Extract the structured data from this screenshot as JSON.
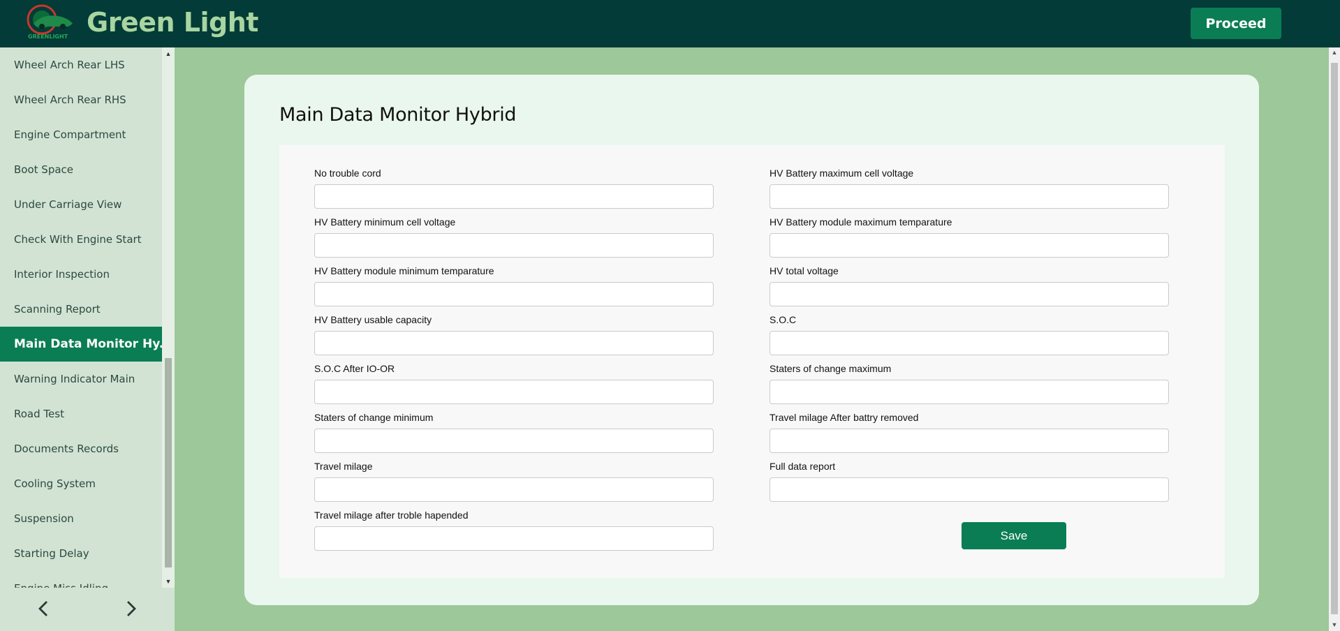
{
  "app": {
    "brand": "Green Light",
    "logo_text": "GREENLIGHT",
    "proceed_label": "Proceed"
  },
  "sidebar": {
    "items": [
      {
        "label": "Wheel Arch Rear LHS",
        "active": false
      },
      {
        "label": "Wheel Arch Rear RHS",
        "active": false
      },
      {
        "label": "Engine Compartment",
        "active": false
      },
      {
        "label": "Boot Space",
        "active": false
      },
      {
        "label": "Under Carriage View",
        "active": false
      },
      {
        "label": "Check With Engine Start",
        "active": false
      },
      {
        "label": "Interior Inspection",
        "active": false
      },
      {
        "label": "Scanning Report",
        "active": false
      },
      {
        "label": "Main Data Monitor Hy...",
        "active": true
      },
      {
        "label": "Warning Indicator Main",
        "active": false
      },
      {
        "label": "Road Test",
        "active": false
      },
      {
        "label": "Documents Records",
        "active": false
      },
      {
        "label": "Cooling System",
        "active": false
      },
      {
        "label": "Suspension",
        "active": false
      },
      {
        "label": "Starting Delay",
        "active": false
      },
      {
        "label": "Engine Miss Idling",
        "active": false
      }
    ],
    "prev_icon": "chevron-left-icon",
    "next_icon": "chevron-right-icon"
  },
  "main": {
    "title": "Main Data Monitor Hybrid",
    "fields": [
      {
        "label": "No trouble cord",
        "value": ""
      },
      {
        "label": "HV Battery maximum cell voltage",
        "value": ""
      },
      {
        "label": "HV Battery minimum cell voltage",
        "value": ""
      },
      {
        "label": "HV Battery module maximum temparature",
        "value": ""
      },
      {
        "label": "HV Battery module minimum temparature",
        "value": ""
      },
      {
        "label": "HV total voltage",
        "value": ""
      },
      {
        "label": "HV Battery usable capacity",
        "value": ""
      },
      {
        "label": "S.O.C",
        "value": ""
      },
      {
        "label": "S.O.C After IO-OR",
        "value": ""
      },
      {
        "label": "Staters of change maximum",
        "value": ""
      },
      {
        "label": "Staters of change minimum",
        "value": ""
      },
      {
        "label": "Travel milage After battry removed",
        "value": ""
      },
      {
        "label": "Travel milage",
        "value": ""
      },
      {
        "label": "Full data report",
        "value": ""
      },
      {
        "label": "Travel milage after troble hapended",
        "value": ""
      }
    ],
    "save_label": "Save"
  },
  "colors": {
    "header_bg": "#023b37",
    "brand_text": "#a8d5a0",
    "accent": "#0a7d55",
    "page_bg": "#9dc89a",
    "sidebar_bg": "#d3e3d3",
    "card_bg": "#eaf7ee"
  }
}
